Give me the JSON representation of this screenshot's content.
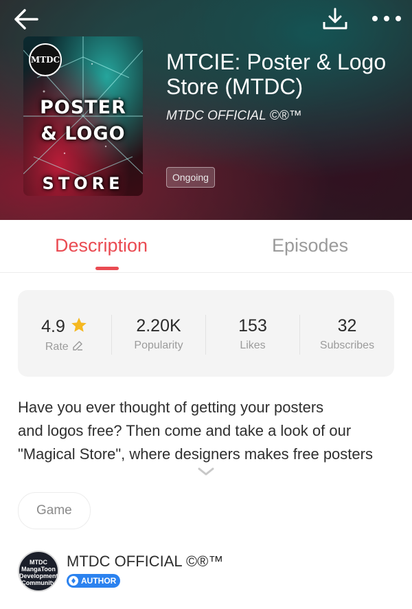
{
  "header": {
    "title": "MTCIE: Poster & Logo Store (MTDC)",
    "author": "MTDC OFFICIAL ©®™",
    "status": "Ongoing",
    "cover": {
      "logo_text": "MTDC",
      "line1": "POSTER",
      "line2": "& LOGO",
      "line3": "STORE"
    },
    "icons": {
      "back": "back-arrow-icon",
      "download": "download-icon",
      "more": "more-dots-icon"
    }
  },
  "tabs": [
    {
      "label": "Description",
      "active": true
    },
    {
      "label": "Episodes",
      "active": false
    }
  ],
  "stats": [
    {
      "value": "4.9",
      "label": "Rate",
      "icon": "star-icon",
      "label_icon": "pencil-icon"
    },
    {
      "value": "2.20K",
      "label": "Popularity"
    },
    {
      "value": "153",
      "label": "Likes"
    },
    {
      "value": "32",
      "label": "Subscribes"
    }
  ],
  "description": {
    "line1": "Have you ever thought of getting your posters",
    "line2": "and logos free? Then come and take a look of our",
    "line3": "\"Magical Store\", where designers makes free posters"
  },
  "tag": "Game",
  "author": {
    "name": "MTDC OFFICIAL ©®™",
    "badge": "AUTHOR",
    "avatar_lines": [
      "MTDC",
      "MangaToon",
      "Development",
      "Community"
    ]
  },
  "colors": {
    "accent": "#ea4b52",
    "badge": "#2b82ef",
    "star": "#f5b820"
  }
}
